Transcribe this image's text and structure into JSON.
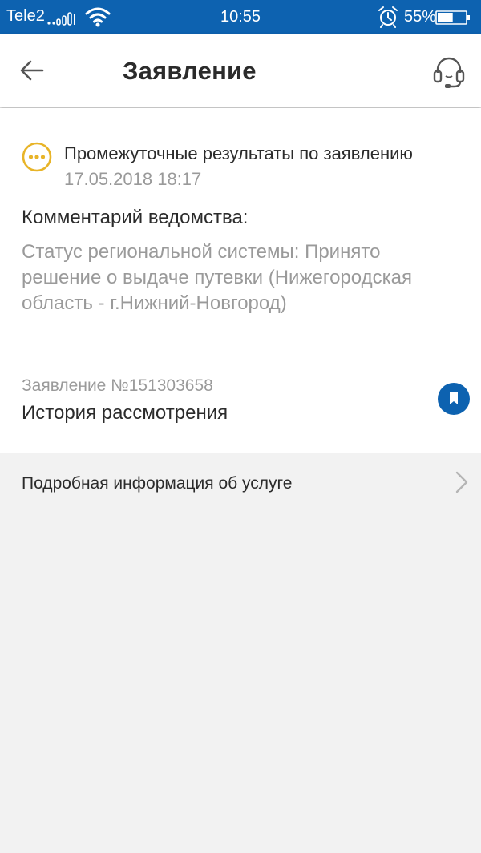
{
  "status_bar": {
    "carrier": "Tele2",
    "time": "10:55",
    "battery": "55%",
    "battery_level": 0.55
  },
  "app_bar": {
    "title": "Заявление"
  },
  "result": {
    "title": "Промежуточные результаты по заявлению",
    "date": "17.05.2018 18:17",
    "accent_color": "#e8b428"
  },
  "comment": {
    "heading": "Комментарий ведомства:",
    "text": "Статус региональной системы: Принято решение о выдаче путевки (Нижегородская область - г.Нижний-Новгород)"
  },
  "application": {
    "number": "Заявление №151303658",
    "history_label": "История рассмотрения"
  },
  "service": {
    "label": "Подробная информация об услуге"
  },
  "colors": {
    "primary": "#0d62b0",
    "text": "#2b2b2b",
    "muted": "#9a9a9a",
    "background": "#f2f2f2"
  }
}
